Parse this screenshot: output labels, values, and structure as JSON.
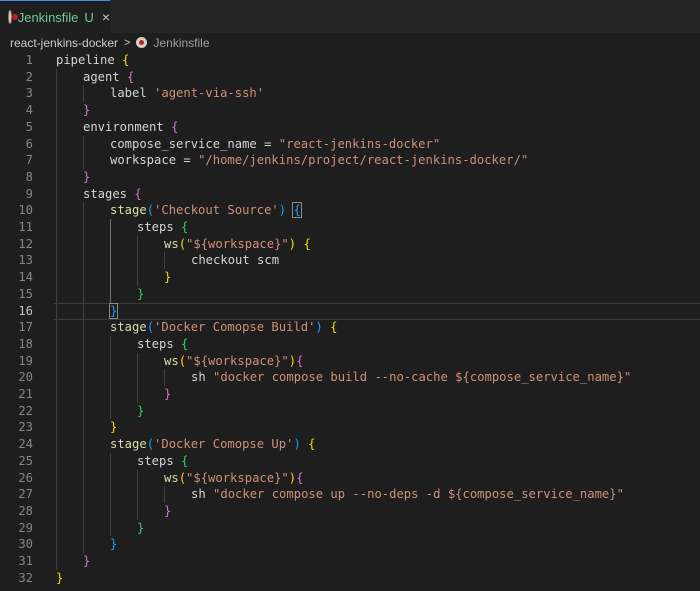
{
  "tab": {
    "filename": "Jenkinsfile",
    "status": "U",
    "close": "×"
  },
  "breadcrumb": {
    "folder": "react-jenkins-docker",
    "separator": ">",
    "file": "Jenkinsfile"
  },
  "editor": {
    "active_line": 16,
    "lines": [
      {
        "n": "1",
        "indent": 0,
        "tokens": [
          [
            "pipeline ",
            ""
          ],
          [
            "{",
            "b1"
          ]
        ]
      },
      {
        "n": "2",
        "indent": 1,
        "tokens": [
          [
            "agent ",
            ""
          ],
          [
            "{",
            "b2"
          ]
        ]
      },
      {
        "n": "3",
        "indent": 2,
        "tokens": [
          [
            "label ",
            ""
          ],
          [
            "'agent-via-ssh'",
            "s"
          ]
        ]
      },
      {
        "n": "4",
        "indent": 1,
        "tokens": [
          [
            "}",
            "b2"
          ]
        ]
      },
      {
        "n": "5",
        "indent": 1,
        "tokens": [
          [
            "environment ",
            ""
          ],
          [
            "{",
            "b2"
          ]
        ]
      },
      {
        "n": "6",
        "indent": 2,
        "tokens": [
          [
            "compose_service_name = ",
            ""
          ],
          [
            "\"react-jenkins-docker\"",
            "s"
          ]
        ]
      },
      {
        "n": "7",
        "indent": 2,
        "tokens": [
          [
            "workspace = ",
            ""
          ],
          [
            "\"/home/jenkins/project/react-jenkins-docker/\"",
            "s"
          ]
        ]
      },
      {
        "n": "8",
        "indent": 1,
        "tokens": [
          [
            "}",
            "b2"
          ]
        ]
      },
      {
        "n": "9",
        "indent": 1,
        "tokens": [
          [
            "stages ",
            ""
          ],
          [
            "{",
            "b2"
          ]
        ]
      },
      {
        "n": "10",
        "indent": 2,
        "tokens": [
          [
            "stage",
            "f"
          ],
          [
            "(",
            "b3"
          ],
          [
            "'Checkout Source'",
            "s"
          ],
          [
            ")",
            "b3"
          ],
          [
            " ",
            ""
          ],
          [
            "{",
            "b3m"
          ]
        ]
      },
      {
        "n": "11",
        "indent": 3,
        "tokens": [
          [
            "steps ",
            ""
          ],
          [
            "{",
            "bg"
          ]
        ]
      },
      {
        "n": "12",
        "indent": 4,
        "tokens": [
          [
            "ws",
            "f"
          ],
          [
            "(",
            "b1"
          ],
          [
            "\"${workspace}\"",
            "s"
          ],
          [
            ")",
            "b1"
          ],
          [
            " ",
            ""
          ],
          [
            "{",
            "b1"
          ]
        ]
      },
      {
        "n": "13",
        "indent": 5,
        "tokens": [
          [
            "checkout scm",
            ""
          ]
        ]
      },
      {
        "n": "14",
        "indent": 4,
        "tokens": [
          [
            "}",
            "b1"
          ]
        ]
      },
      {
        "n": "15",
        "indent": 3,
        "tokens": [
          [
            "}",
            "bg"
          ]
        ]
      },
      {
        "n": "16",
        "indent": 2,
        "tokens": [
          [
            "}",
            "b3m"
          ]
        ]
      },
      {
        "n": "17",
        "indent": 2,
        "tokens": [
          [
            "stage",
            "f"
          ],
          [
            "(",
            "b3"
          ],
          [
            "'Docker Comopse Build'",
            "s"
          ],
          [
            ")",
            "b3"
          ],
          [
            " ",
            ""
          ],
          [
            "{",
            "b1"
          ]
        ]
      },
      {
        "n": "18",
        "indent": 3,
        "tokens": [
          [
            "steps ",
            ""
          ],
          [
            "{",
            "bg"
          ]
        ]
      },
      {
        "n": "19",
        "indent": 4,
        "tokens": [
          [
            "ws",
            "f"
          ],
          [
            "(",
            "b1"
          ],
          [
            "\"${workspace}\"",
            "s"
          ],
          [
            ")",
            "b1"
          ],
          [
            "{",
            "b2"
          ]
        ]
      },
      {
        "n": "20",
        "indent": 5,
        "tokens": [
          [
            "sh ",
            ""
          ],
          [
            "\"docker compose build --no-cache ${compose_service_name}\"",
            "s"
          ]
        ]
      },
      {
        "n": "21",
        "indent": 4,
        "tokens": [
          [
            "}",
            "b2"
          ]
        ]
      },
      {
        "n": "22",
        "indent": 3,
        "tokens": [
          [
            "}",
            "bg"
          ]
        ]
      },
      {
        "n": "23",
        "indent": 2,
        "tokens": [
          [
            "}",
            "b1"
          ]
        ]
      },
      {
        "n": "24",
        "indent": 2,
        "tokens": [
          [
            "stage",
            "f"
          ],
          [
            "(",
            "b3"
          ],
          [
            "'Docker Comopse Up'",
            "s"
          ],
          [
            ")",
            "b3"
          ],
          [
            " ",
            ""
          ],
          [
            "{",
            "b1"
          ]
        ]
      },
      {
        "n": "25",
        "indent": 3,
        "tokens": [
          [
            "steps ",
            ""
          ],
          [
            "{",
            "bg"
          ]
        ]
      },
      {
        "n": "26",
        "indent": 4,
        "tokens": [
          [
            "ws",
            "f"
          ],
          [
            "(",
            "b1"
          ],
          [
            "\"${workspace}\"",
            "s"
          ],
          [
            ")",
            "b1"
          ],
          [
            "{",
            "b2"
          ]
        ]
      },
      {
        "n": "27",
        "indent": 5,
        "tokens": [
          [
            "sh ",
            ""
          ],
          [
            "\"docker compose up --no-deps -d ${compose_service_name}\"",
            "s"
          ]
        ]
      },
      {
        "n": "28",
        "indent": 4,
        "tokens": [
          [
            "}",
            "b2"
          ]
        ]
      },
      {
        "n": "29",
        "indent": 3,
        "tokens": [
          [
            "}",
            "bg"
          ]
        ]
      },
      {
        "n": "30",
        "indent": 2,
        "tokens": [
          [
            "}",
            "b3"
          ]
        ]
      },
      {
        "n": "31",
        "indent": 1,
        "tokens": [
          [
            "}",
            "b2"
          ]
        ]
      },
      {
        "n": "32",
        "indent": 0,
        "tokens": [
          [
            "}",
            "b1"
          ]
        ]
      }
    ]
  }
}
